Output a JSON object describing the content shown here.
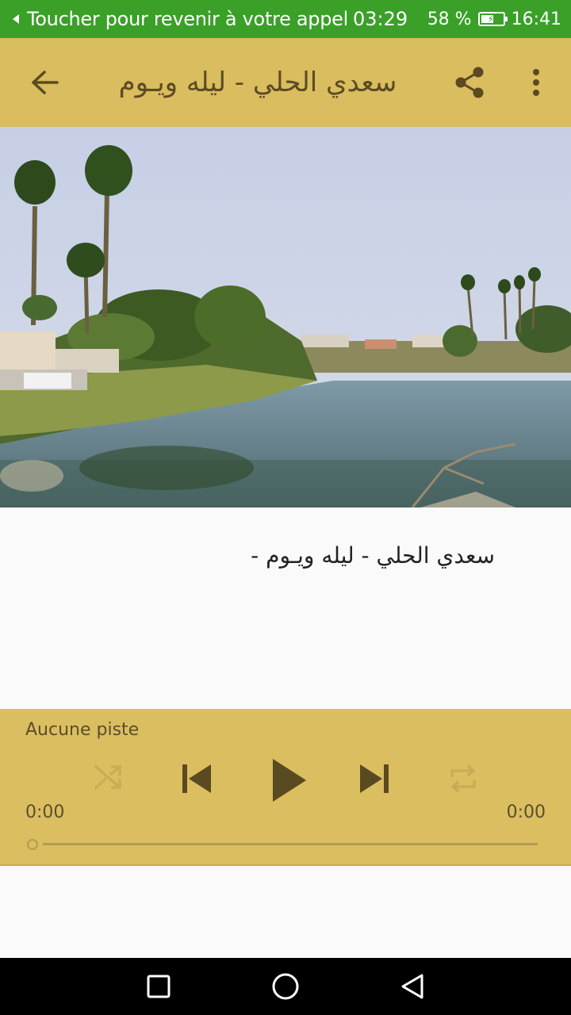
{
  "status_bar": {
    "call_text": "Toucher pour revenir à votre appel",
    "call_time": "03:29",
    "battery_percent": "58 %",
    "battery_level": 0.58,
    "clock": "16:41"
  },
  "app_bar": {
    "title": "سعدي الحلي  - ليله ويـوم",
    "icons": [
      "back-arrow-icon",
      "share-icon",
      "more-vert-icon"
    ]
  },
  "content": {
    "description": "سعدي الحلي  - ليله ويـوم -"
  },
  "player": {
    "track_label": "Aucune piste",
    "time_elapsed": "0:00",
    "time_total": "0:00",
    "progress": 0,
    "icons": [
      "shuffle-icon",
      "skip-previous-icon",
      "play-icon",
      "skip-next-icon",
      "repeat-icon"
    ]
  },
  "nav_bar": {
    "icons": [
      "recents-square-icon",
      "home-circle-icon",
      "back-triangle-icon"
    ]
  },
  "colors": {
    "status_bar": "#3aa028",
    "app_bar": "#d9bd5e",
    "player": "#dabe60",
    "icon_dark": "#5a4a22"
  }
}
